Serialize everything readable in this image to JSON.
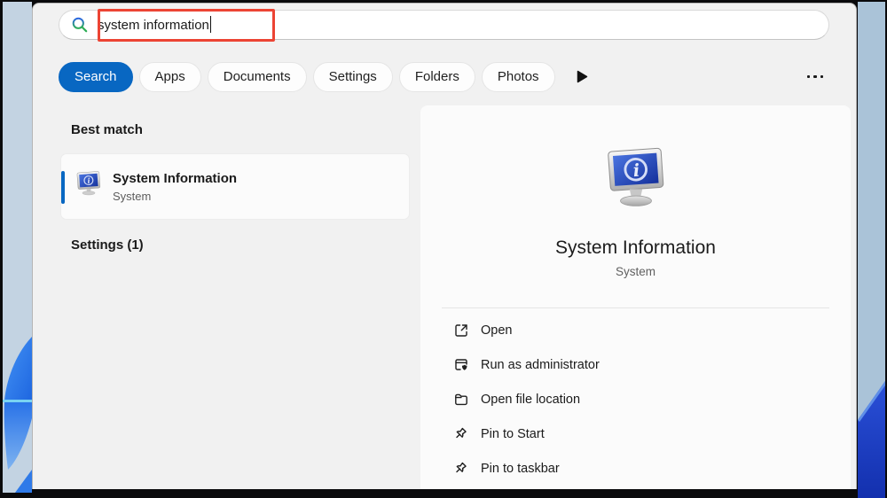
{
  "search": {
    "value": "system information",
    "icon": "search-icon"
  },
  "tabs": [
    {
      "label": "Search",
      "active": true
    },
    {
      "label": "Apps",
      "active": false
    },
    {
      "label": "Documents",
      "active": false
    },
    {
      "label": "Settings",
      "active": false
    },
    {
      "label": "Folders",
      "active": false
    },
    {
      "label": "Photos",
      "active": false
    }
  ],
  "left_pane": {
    "best_match_heading": "Best match",
    "best_match": {
      "title": "System Information",
      "subtitle": "System",
      "icon": "system-information-app-icon"
    },
    "settings_heading": "Settings (1)"
  },
  "detail_panel": {
    "title": "System Information",
    "subtitle": "System",
    "icon": "system-information-app-icon",
    "actions": [
      {
        "label": "Open",
        "icon": "open-external-icon"
      },
      {
        "label": "Run as administrator",
        "icon": "admin-shield-icon"
      },
      {
        "label": "Open file location",
        "icon": "folder-icon"
      },
      {
        "label": "Pin to Start",
        "icon": "pin-icon"
      },
      {
        "label": "Pin to taskbar",
        "icon": "pin-icon"
      }
    ]
  },
  "colors": {
    "accent_blue": "#0867c2",
    "annotation_red": "#ec4434",
    "app_icon_screen_blue": "#1e3fae"
  }
}
